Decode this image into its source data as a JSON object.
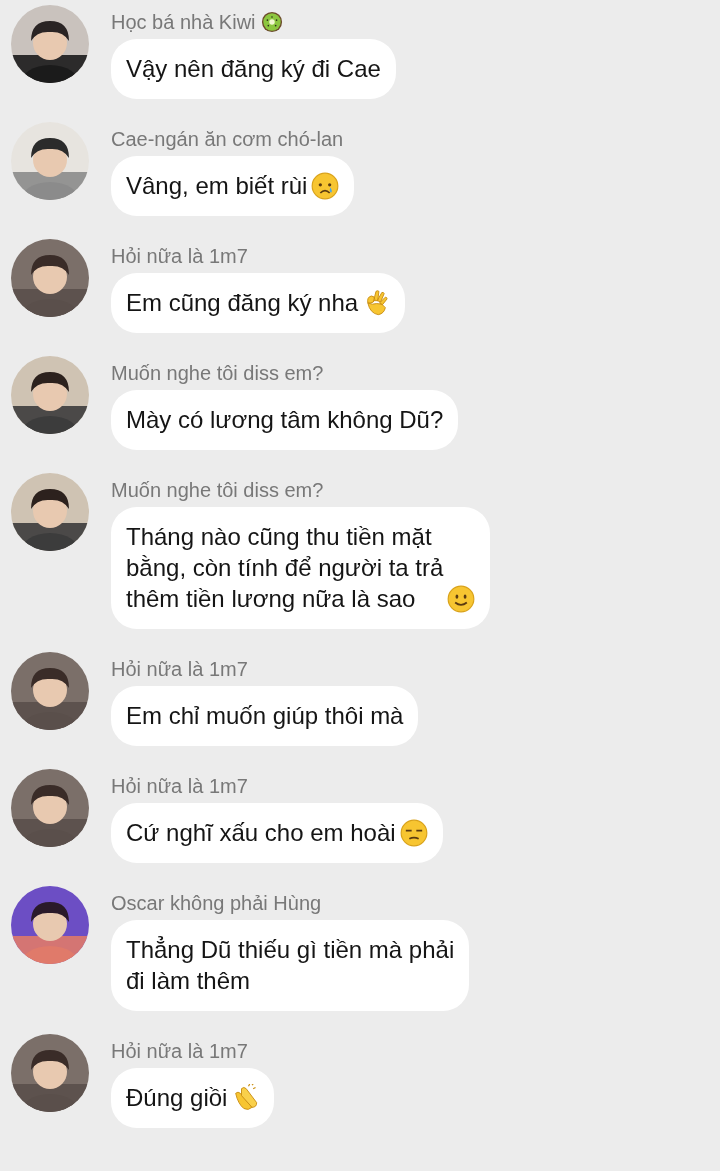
{
  "messages": [
    {
      "sender": "Học bá nhà Kiwi",
      "lines": [
        "Vậy nên đăng ký đi Cae"
      ]
    },
    {
      "sender": "Cae-ngán ăn cơm chó-lan",
      "lines": [
        "Vâng, em biết rùi"
      ]
    },
    {
      "sender": "Hỏi nữa là 1m7",
      "lines": [
        "Em cũng đăng ký nha"
      ]
    },
    {
      "sender": "Muốn nghe tôi diss em?",
      "lines": [
        "Mày có lương tâm không Dũ?"
      ]
    },
    {
      "sender": "Muốn nghe tôi diss em?",
      "lines": [
        "Tháng nào cũng thu tiền mặt",
        "bằng, còn tính để người ta trả",
        "thêm tiền lương nữa là sao"
      ]
    },
    {
      "sender": "Hỏi nữa là 1m7",
      "lines": [
        "Em chỉ muốn giúp thôi mà"
      ]
    },
    {
      "sender": "Hỏi nữa là 1m7",
      "lines": [
        "Cứ nghĩ xấu cho em hoài"
      ]
    },
    {
      "sender": "Oscar không phải Hùng",
      "lines": [
        "Thẳng Dũ thiếu gì tiền mà phải",
        "đi làm thêm"
      ]
    },
    {
      "sender": "Hỏi nữa là 1m7",
      "lines": [
        "Đúng giồi"
      ]
    }
  ]
}
